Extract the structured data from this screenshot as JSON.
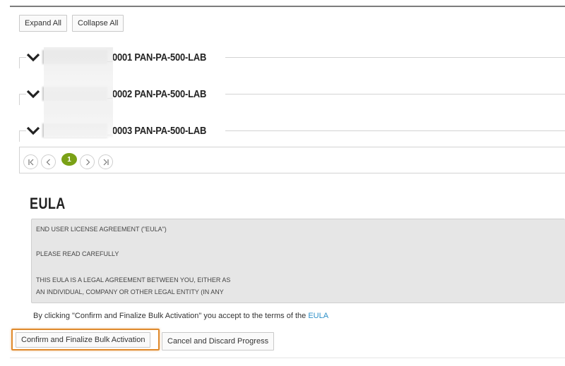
{
  "toolbar": {
    "expand_all": "Expand All",
    "collapse_all": "Collapse All"
  },
  "groups": [
    {
      "suffix": "_0001 PAN-PA-500-LAB",
      "expanded": true
    },
    {
      "suffix": "_0002 PAN-PA-500-LAB",
      "expanded": true
    },
    {
      "suffix": "_0003 PAN-PA-500-LAB",
      "expanded": true
    }
  ],
  "pager": {
    "current_page": "1",
    "first_icon": "first-page-icon",
    "prev_icon": "prev-page-icon",
    "next_icon": "next-page-icon",
    "last_icon": "last-page-icon",
    "accent": "#7aa116"
  },
  "eula": {
    "heading": "EULA",
    "lines": [
      "END USER LICENSE AGREEMENT (\"EULA\")",
      "PLEASE READ CAREFULLY",
      "THIS EULA IS A LEGAL AGREEMENT BETWEEN YOU, EITHER AS",
      "AN INDIVIDUAL, COMPANY OR OTHER LEGAL ENTITY (IN ANY"
    ],
    "accept_prefix": "By clicking \"Confirm and Finalize Bulk Activation\" you accept to the terms of the ",
    "accept_link": "EULA",
    "link_color": "#2b8fc8"
  },
  "actions": {
    "confirm": "Confirm and Finalize Bulk Activation",
    "cancel": "Cancel and Discard Progress",
    "highlight_color": "#e08a2c"
  }
}
